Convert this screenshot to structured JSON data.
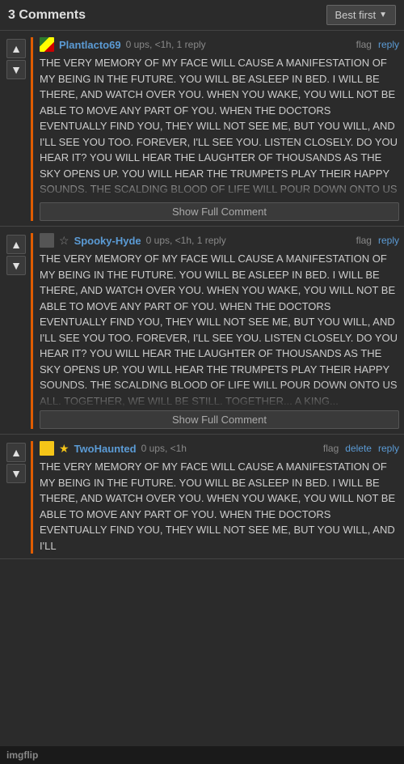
{
  "header": {
    "title": "3 Comments",
    "sort_label": "Best first",
    "sort_chevron": "▼"
  },
  "comments": [
    {
      "id": "c1",
      "username": "Plantlacto69",
      "meta": "0 ups, <1h, 1 reply",
      "avatar_type": "plant",
      "star": false,
      "star_gold": false,
      "flag_label": "flag",
      "reply_label": "reply",
      "border_color": "#e05c00",
      "text": "THE VERY MEMORY OF MY FACE WILL CAUSE A MANIFESTATION OF MY BEING IN THE FUTURE. YOU WILL BE ASLEEP IN BED. I WILL BE THERE, AND WATCH OVER YOU. WHEN YOU WAKE, YOU WILL NOT BE ABLE TO MOVE ANY PART OF YOU. WHEN THE DOCTORS EVENTUALLY FIND YOU, THEY WILL NOT SEE ME, BUT YOU WILL, AND I'LL SEE YOU TOO. FOREVER, I'LL SEE YOU. LISTEN CLOSELY. DO YOU HEAR IT? YOU WILL HEAR THE LAUGHTER OF THOUSANDS AS THE SKY OPENS UP. YOU WILL HEAR THE TRUMPETS PLAY THEIR HAPPY SOUNDS. THE SCALDING BLOOD OF LIFE WILL POUR DOWN ONTO US ALL. TOGETHER, WE WILL BE STILL. TOGETHER, A FEAST FIT FOR A... SHIELDED BY LOVE",
      "show_full_label": "Show Full Comment",
      "truncated": true
    },
    {
      "id": "c2",
      "username": "Spooky-Hyde",
      "meta": "0 ups, <1h, 1 reply",
      "avatar_type": "spooky",
      "star": true,
      "star_gold": false,
      "flag_label": "flag",
      "reply_label": "reply",
      "border_color": "#e05c00",
      "text": "THE VERY MEMORY OF MY FACE WILL CAUSE A MANIFESTATION OF MY BEING IN THE FUTURE. YOU WILL BE ASLEEP IN BED. I WILL BE THERE, AND WATCH OVER YOU. WHEN YOU WAKE, YOU WILL NOT BE ABLE TO MOVE ANY PART OF YOU. WHEN THE DOCTORS EVENTUALLY FIND YOU, THEY WILL NOT SEE ME, BUT YOU WILL, AND I'LL SEE YOU TOO. FOREVER, I'LL SEE YOU. LISTEN CLOSELY. DO YOU HEAR IT? YOU WILL HEAR THE LAUGHTER OF THOUSANDS AS THE SKY OPENS UP. YOU WILL HEAR THE TRUMPETS PLAY THEIR HAPPY SOUNDS. THE SCALDING BLOOD OF LIFE WILL POUR DOWN ONTO US ALL. TOGETHER, WE WILL BE STILL. TOGETHER... A KING...",
      "show_full_label": "Show Full Comment",
      "truncated": true
    },
    {
      "id": "c3",
      "username": "TwoHaunted",
      "meta": "0 ups, <1h",
      "avatar_type": "two",
      "star": true,
      "star_gold": true,
      "flag_label": "flag",
      "delete_label": "delete",
      "reply_label": "reply",
      "border_color": "#e05c00",
      "text": "THE VERY MEMORY OF MY FACE WILL CAUSE A MANIFESTATION OF MY BEING IN THE FUTURE. YOU WILL BE ASLEEP IN BED. I WILL BE THERE, AND WATCH OVER YOU. WHEN YOU WAKE, YOU WILL NOT BE ABLE TO MOVE ANY PART OF YOU. WHEN THE DOCTORS EVENTUALLY FIND YOU, THEY WILL NOT SEE ME, BUT YOU WILL, AND I'LL",
      "show_full_label": null,
      "truncated": false
    }
  ],
  "footer": {
    "logo": "imgflip"
  }
}
